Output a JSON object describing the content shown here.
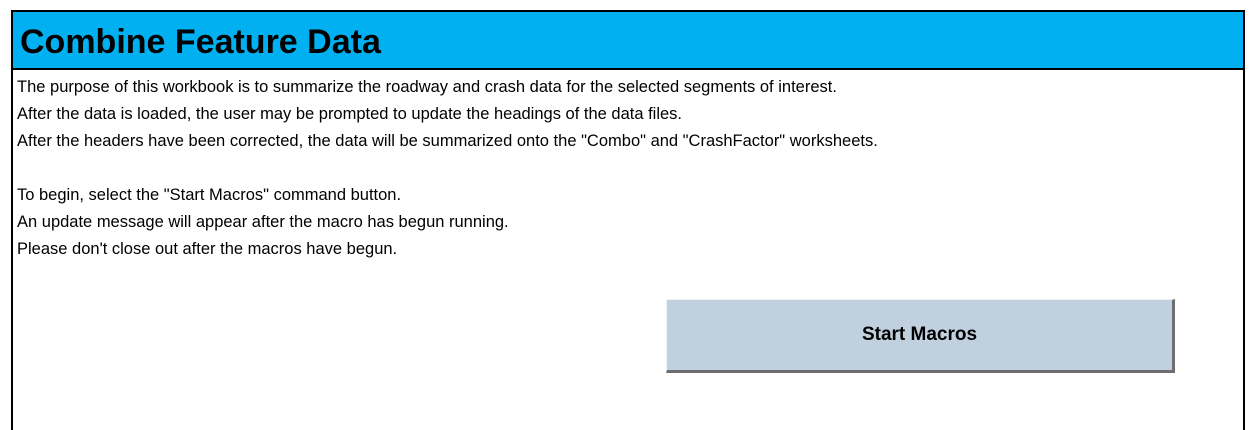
{
  "header": {
    "title": "Combine Feature Data"
  },
  "instructions": {
    "lines": [
      "The purpose of this workbook is to summarize the roadway and crash data for the selected segments of interest.",
      "After the data is loaded, the user may be prompted to update the headings of the data files.",
      "After the headers have been corrected, the data will be summarized onto the \"Combo\" and \"CrashFactor\" worksheets.",
      "",
      "To begin, select the \"Start Macros\" command button.",
      "An update message will appear after the macro has begun running.",
      "Please don't close out after the macros have begun."
    ]
  },
  "button": {
    "start_label": "Start Macros"
  },
  "colors": {
    "title_bar": "#00b0f0",
    "button_face": "#c0d0de"
  }
}
